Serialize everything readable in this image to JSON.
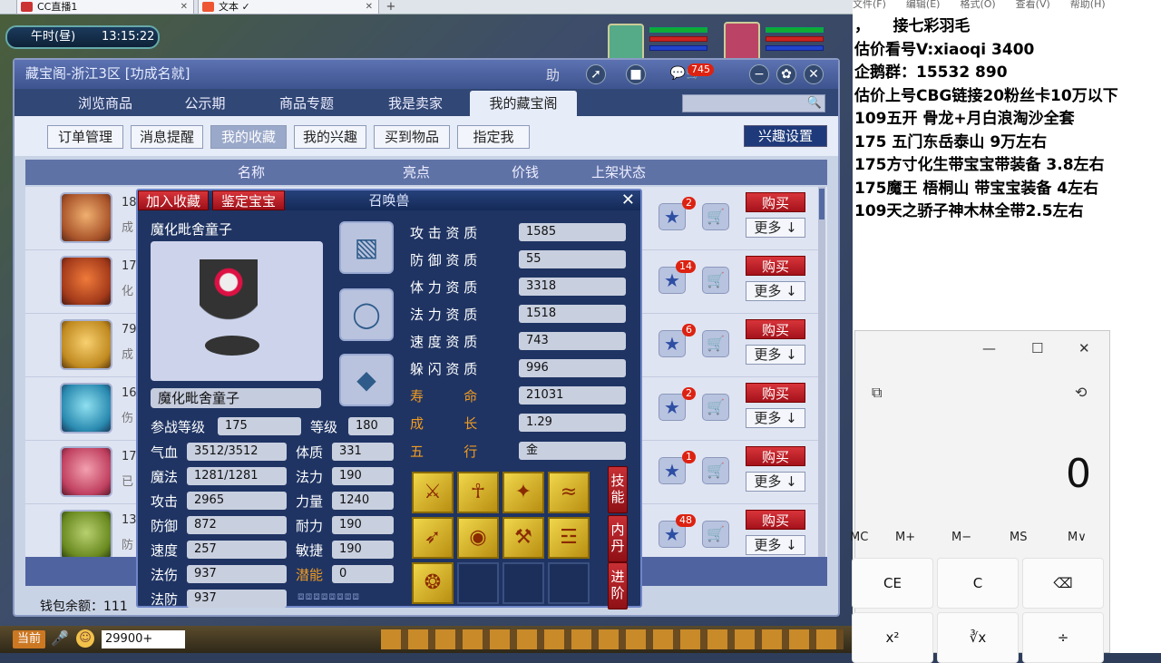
{
  "browser": {
    "tabs": [
      {
        "title": "CC直播1",
        "close": "✕"
      },
      {
        "title": "文本 ✓",
        "close": "✕"
      }
    ],
    "new_tab": "+"
  },
  "game": {
    "time_label": "午时(昼)",
    "clock": "13:15:22",
    "window": {
      "title": "藏宝阁-浙江3区 [功成名就]",
      "help_label": "助",
      "message_badge": "745",
      "nav_tabs": [
        "浏览商品",
        "公示期",
        "商品专题",
        "我是卖家",
        "我的藏宝阁"
      ],
      "sub_tabs": [
        "订单管理",
        "消息提醒",
        "我的收藏",
        "我的兴趣",
        "买到物品",
        "指定我"
      ],
      "interest_settings": "兴趣设置",
      "table_headers": [
        "名称",
        "亮点",
        "价钱",
        "上架状态"
      ],
      "rows": [
        {
          "name": "18",
          "sub": "成",
          "fav_count": "2"
        },
        {
          "name": "17",
          "sub": "化",
          "fav_count": "14"
        },
        {
          "name": "79",
          "sub": "成",
          "fav_count": "6"
        },
        {
          "name": "16",
          "sub": "伤",
          "fav_count": "2"
        },
        {
          "name": "17",
          "sub": "已",
          "fav_count": "1"
        },
        {
          "name": "13",
          "sub": "防",
          "fav_count": "48"
        }
      ],
      "buy_label": "购买",
      "more_label": "更多 ↓",
      "wallet": "钱包余额：111"
    },
    "pet_dialog": {
      "add_fav": "加入收藏",
      "appraise": "鉴定宝宝",
      "title": "召唤兽",
      "close": "✕",
      "name_header": "魔化毗舍童子",
      "name_bar": "魔化毗舍童子",
      "left_stats": [
        {
          "label": "参战等级",
          "value": "175"
        },
        {
          "label": "气血",
          "value": "3512/3512"
        },
        {
          "label": "魔法",
          "value": "1281/1281"
        },
        {
          "label": "攻击",
          "value": "2965"
        },
        {
          "label": "防御",
          "value": "872"
        },
        {
          "label": "速度",
          "value": "257"
        },
        {
          "label": "法伤",
          "value": "937"
        },
        {
          "label": "法防",
          "value": "937"
        }
      ],
      "mid_stats": [
        {
          "label": "等级",
          "value": "180"
        },
        {
          "label": "体质",
          "value": "331"
        },
        {
          "label": "法力",
          "value": "190"
        },
        {
          "label": "力量",
          "value": "1240"
        },
        {
          "label": "耐力",
          "value": "190"
        },
        {
          "label": "敏捷",
          "value": "190"
        },
        {
          "label": "潜能",
          "value": "0"
        }
      ],
      "aptitudes": [
        {
          "label": "攻 击 资 质",
          "value": "1585"
        },
        {
          "label": "防 御 资 质",
          "value": "55"
        },
        {
          "label": "体 力 资 质",
          "value": "3318"
        },
        {
          "label": "法 力 资 质",
          "value": "1518"
        },
        {
          "label": "速 度 资 质",
          "value": "743"
        },
        {
          "label": "躲 闪 资 质",
          "value": "996"
        },
        {
          "label": "寿 　 　 命",
          "value": "21031"
        },
        {
          "label": "成 　 　 长",
          "value": "1.29"
        },
        {
          "label": "五 　 　 行",
          "value": "金"
        }
      ],
      "side_buttons": [
        "技能",
        "内丹",
        "进阶"
      ]
    },
    "chat": {
      "current_channel": "当前",
      "input_value": "29900+"
    }
  },
  "notepad": {
    "menu": "文件(F)　　编辑(E)　　格式(O)　　查看(V)　　帮助(H)",
    "lines": [
      "，　　接七彩羽毛",
      "估价看号V:xiaoqi 3400",
      "企鹅群：15532 890",
      "估价上号CBG链接20粉丝卡10万以下",
      "109五开 骨龙+月白浪淘沙全套",
      "175 五门东岳泰山  9万左右",
      "175方寸化生带宝宝带装备  3.8左右",
      "175魔王 梧桐山  带宝宝装备 4左右",
      "109天之骄子神木林全带2.5左右"
    ]
  },
  "calculator": {
    "display": "0",
    "memory": [
      "MC",
      "M+",
      "M−",
      "MS",
      "M∨"
    ],
    "keys": [
      "CE",
      "C",
      "⌫",
      "x²",
      "∛x",
      "÷"
    ]
  }
}
